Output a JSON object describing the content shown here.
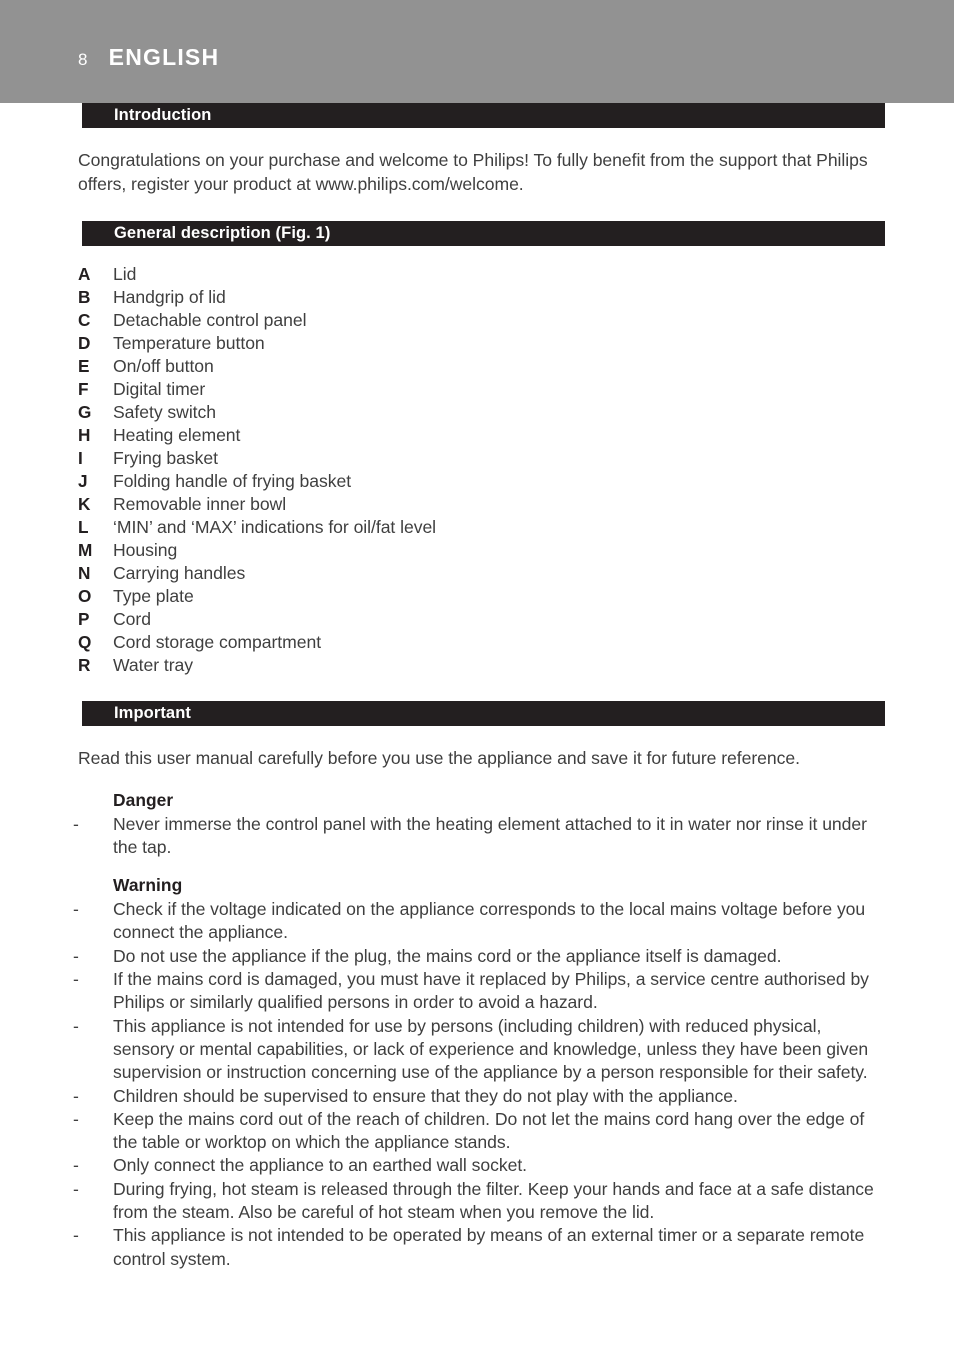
{
  "header": {
    "folio": "8",
    "running_title": "ENGLISH",
    "band_color": "#929292"
  },
  "theme": {
    "section_bar_color": "#231f20",
    "body_text_color": "#3f3f3f",
    "page_background": "#ffffff"
  },
  "sections": {
    "introduction": {
      "bar_label": "Introduction",
      "paragraph": "Congratulations on your purchase and welcome to Philips! To fully benefit from the support that Philips offers, register your product at www.philips.com/welcome."
    },
    "general_description": {
      "bar_label": "General description (Fig. 1)",
      "parts": [
        {
          "letter": "A",
          "text": "Lid"
        },
        {
          "letter": "B",
          "text": "Handgrip of lid"
        },
        {
          "letter": "C",
          "text": "Detachable control panel"
        },
        {
          "letter": "D",
          "text": "Temperature button"
        },
        {
          "letter": "E",
          "text": "On/off button"
        },
        {
          "letter": "F",
          "text": "Digital timer"
        },
        {
          "letter": "G",
          "text": "Safety switch"
        },
        {
          "letter": "H",
          "text": "Heating element"
        },
        {
          "letter": "I",
          "text": "Frying basket"
        },
        {
          "letter": "J",
          "text": "Folding handle of frying basket"
        },
        {
          "letter": "K",
          "text": "Removable inner bowl"
        },
        {
          "letter": "L",
          "text": "‘MIN’ and ‘MAX’ indications for oil/fat level"
        },
        {
          "letter": "M",
          "text": "Housing"
        },
        {
          "letter": "N",
          "text": "Carrying handles"
        },
        {
          "letter": "O",
          "text": "Type plate"
        },
        {
          "letter": "P",
          "text": "Cord"
        },
        {
          "letter": "Q",
          "text": "Cord storage compartment"
        },
        {
          "letter": "R",
          "text": "Water tray"
        }
      ]
    },
    "important": {
      "bar_label": "Important",
      "paragraph": "Read this user manual carefully before you use the appliance and save it for future reference.",
      "danger": {
        "heading": "Danger",
        "bullet_marker": "-",
        "bullets": [
          "Never immerse the control panel with the heating element attached to it in water nor rinse it under the tap."
        ]
      },
      "warning": {
        "heading": "Warning",
        "bullet_marker": "-",
        "bullets": [
          "Check if the voltage indicated on the appliance corresponds to the local mains voltage before you connect the appliance.",
          "Do not use the appliance if the plug, the mains cord or the appliance itself is damaged.",
          "If the mains cord is damaged, you must have it replaced by Philips, a service centre authorised by Philips or similarly qualified persons in order to avoid a hazard.",
          "This appliance is not intended for use by persons (including children) with reduced physical, sensory or mental capabilities, or lack of experience and knowledge, unless they have been given supervision or instruction concerning use of the appliance by a person responsible for their safety.",
          "Children should be supervised to ensure that they do not play with the appliance.",
          "Keep the mains cord out of the reach of children. Do not let the mains cord hang over the edge of the table or worktop on which the appliance stands.",
          "Only connect the appliance to an earthed wall socket.",
          "During frying, hot steam is released through the filter. Keep your hands and face at a safe distance from the steam. Also be careful of hot steam when you remove the lid.",
          "This appliance is not intended to be operated by means of an external timer or a separate remote control system."
        ]
      }
    }
  }
}
